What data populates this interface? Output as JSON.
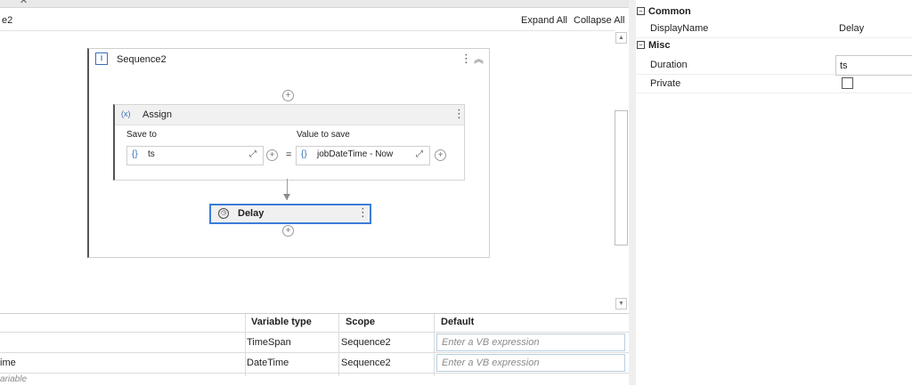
{
  "designer": {
    "breadcrumb": "e2",
    "expand_all": "Expand All",
    "collapse_all": "Collapse All"
  },
  "sequence": {
    "title": "Sequence2",
    "icon": "sequence-icon"
  },
  "assign": {
    "title": "Assign",
    "icon_glyph": "(x)",
    "save_to_label": "Save to",
    "value_label": "Value to save",
    "save_to_value": "ts",
    "value_expression": "jobDateTime - Now",
    "equals": "="
  },
  "delay": {
    "title": "Delay",
    "icon": "clock-icon"
  },
  "variables": {
    "headers": {
      "type": "Variable type",
      "scope": "Scope",
      "default": "Default"
    },
    "rows": [
      {
        "name": "",
        "type": "TimeSpan",
        "scope": "Sequence2",
        "default_placeholder": "Enter a VB expression"
      },
      {
        "name": "ime",
        "type": "DateTime",
        "scope": "Sequence2",
        "default_placeholder": "Enter a VB expression"
      }
    ],
    "create_hint": "ariable"
  },
  "properties": {
    "categories": [
      {
        "name": "Common",
        "rows": [
          {
            "name": "DisplayName",
            "value": "Delay"
          }
        ]
      },
      {
        "name": "Misc",
        "rows": [
          {
            "name": "Duration",
            "value": "ts"
          },
          {
            "name": "Private",
            "value": ""
          }
        ]
      }
    ]
  },
  "colors": {
    "accent": "#3b7dd8",
    "icon_blue": "#3a6fb5"
  }
}
